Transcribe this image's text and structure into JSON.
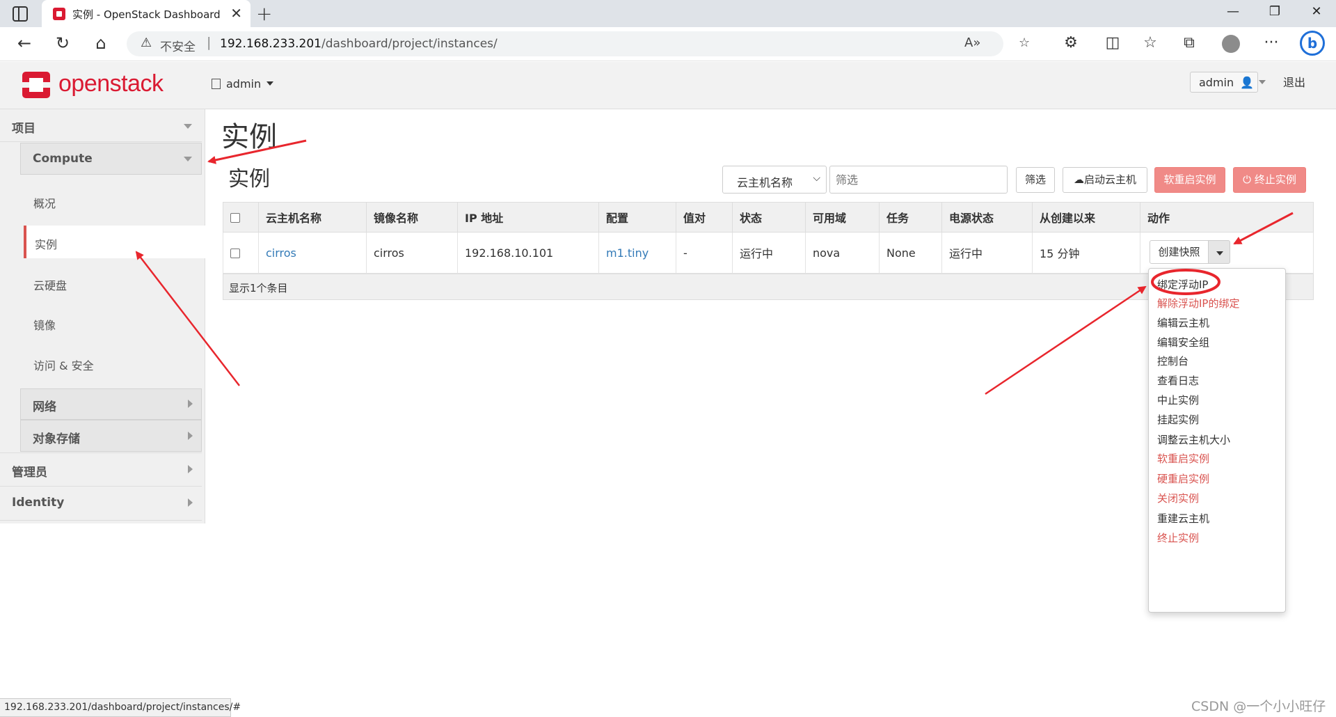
{
  "browser": {
    "tab_title": "实例 - OpenStack Dashboard",
    "address": {
      "insecure_label": "不安全",
      "separator": "|",
      "host": "192.168.233.201",
      "path": "/dashboard/project/instances/"
    },
    "status_url": "192.168.233.201/dashboard/project/instances/#"
  },
  "header": {
    "logo_text": "openstack",
    "project_menu": "admin",
    "user_menu": "admin",
    "logout": "退出",
    "brand_color": "#da1a32"
  },
  "sidebar": {
    "project": "项目",
    "compute": "Compute",
    "links": [
      "概况",
      "实例",
      "云硬盘",
      "镜像",
      "访问 & 安全"
    ],
    "network": "网络",
    "object_storage": "对象存储",
    "admin": "管理员",
    "identity": "Identity",
    "active_link": "实例"
  },
  "main": {
    "page_title": "实例",
    "section_title": "实例",
    "filter_select": "云主机名称",
    "filter_placeholder": "筛选",
    "filter_button": "筛选",
    "launch_button": "启动云主机",
    "soft_reboot_button": "软重启实例",
    "terminate_button": "终止实例",
    "table": {
      "columns": [
        "云主机名称",
        "镜像名称",
        "IP 地址",
        "配置",
        "值对",
        "状态",
        "可用域",
        "任务",
        "电源状态",
        "从创建以来",
        "动作"
      ],
      "rows": [
        {
          "name": "cirros",
          "image": "cirros",
          "ip": "192.168.10.101",
          "flavor": "m1.tiny",
          "keypair": "-",
          "status": "运行中",
          "zone": "nova",
          "task": "None",
          "power": "运行中",
          "age": "15 分钟",
          "action": "创建快照"
        }
      ],
      "footer": "显示1个条目"
    },
    "action_menu": [
      {
        "label": "绑定浮动IP",
        "danger": false
      },
      {
        "label": "解除浮动IP的绑定",
        "danger": true
      },
      {
        "label": "编辑云主机",
        "danger": false
      },
      {
        "label": "编辑安全组",
        "danger": false
      },
      {
        "label": "控制台",
        "danger": false
      },
      {
        "label": "查看日志",
        "danger": false
      },
      {
        "label": "中止实例",
        "danger": false
      },
      {
        "label": "挂起实例",
        "danger": false
      },
      {
        "label": "调整云主机大小",
        "danger": false
      },
      {
        "label": "软重启实例",
        "danger": true
      },
      {
        "label": "硬重启实例",
        "danger": true
      },
      {
        "label": "关闭实例",
        "danger": true
      },
      {
        "label": "重建云主机",
        "danger": false
      },
      {
        "label": "终止实例",
        "danger": true
      }
    ]
  },
  "watermark": "CSDN @一个小小旺仔",
  "colors": {
    "danger": "#d9534f",
    "link": "#337ab7",
    "annotation": "#e8262d"
  }
}
